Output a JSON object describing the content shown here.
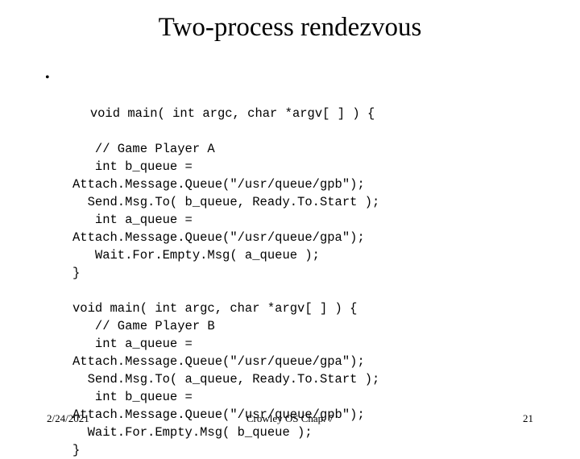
{
  "slide": {
    "title": "Two-process rendezvous",
    "bullet_marker": "•",
    "code_lines": [
      "void main( int argc, char *argv[ ] ) {",
      "   // Game Player A",
      "   int b_queue =",
      "Attach.Message.Queue(\"/usr/queue/gpb\");",
      "  Send.Msg.To( b_queue, Ready.To.Start );",
      "   int a_queue =",
      "Attach.Message.Queue(\"/usr/queue/gpa\");",
      "   Wait.For.Empty.Msg( a_queue );",
      "}",
      "",
      "void main( int argc, char *argv[ ] ) {",
      "   // Game Player B",
      "   int a_queue =",
      "Attach.Message.Queue(\"/usr/queue/gpa\");",
      "  Send.Msg.To( a_queue, Ready.To.Start );",
      "   int b_queue =",
      "Attach.Message.Queue(\"/usr/queue/gpb\");",
      "  Wait.For.Empty.Msg( b_queue );",
      "}"
    ],
    "footer": {
      "date": "2/24/2021",
      "center": "Crowley  OS   Chap. 7",
      "page_number": "21"
    }
  }
}
